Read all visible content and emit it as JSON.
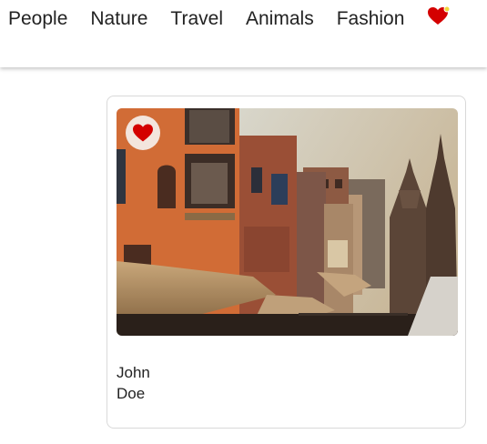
{
  "nav": {
    "items": [
      {
        "label": "People"
      },
      {
        "label": "Nature"
      },
      {
        "label": "Travel"
      },
      {
        "label": "Animals"
      },
      {
        "label": "Fashion"
      }
    ],
    "favorites_icon": "heart-icon",
    "favorites_indicator_color": "#f2d63a"
  },
  "card": {
    "image_icon": "photo-city-street",
    "like_icon": "heart-icon",
    "like_color": "#d40000",
    "author": {
      "first_name": "John",
      "last_name": "Doe"
    }
  }
}
